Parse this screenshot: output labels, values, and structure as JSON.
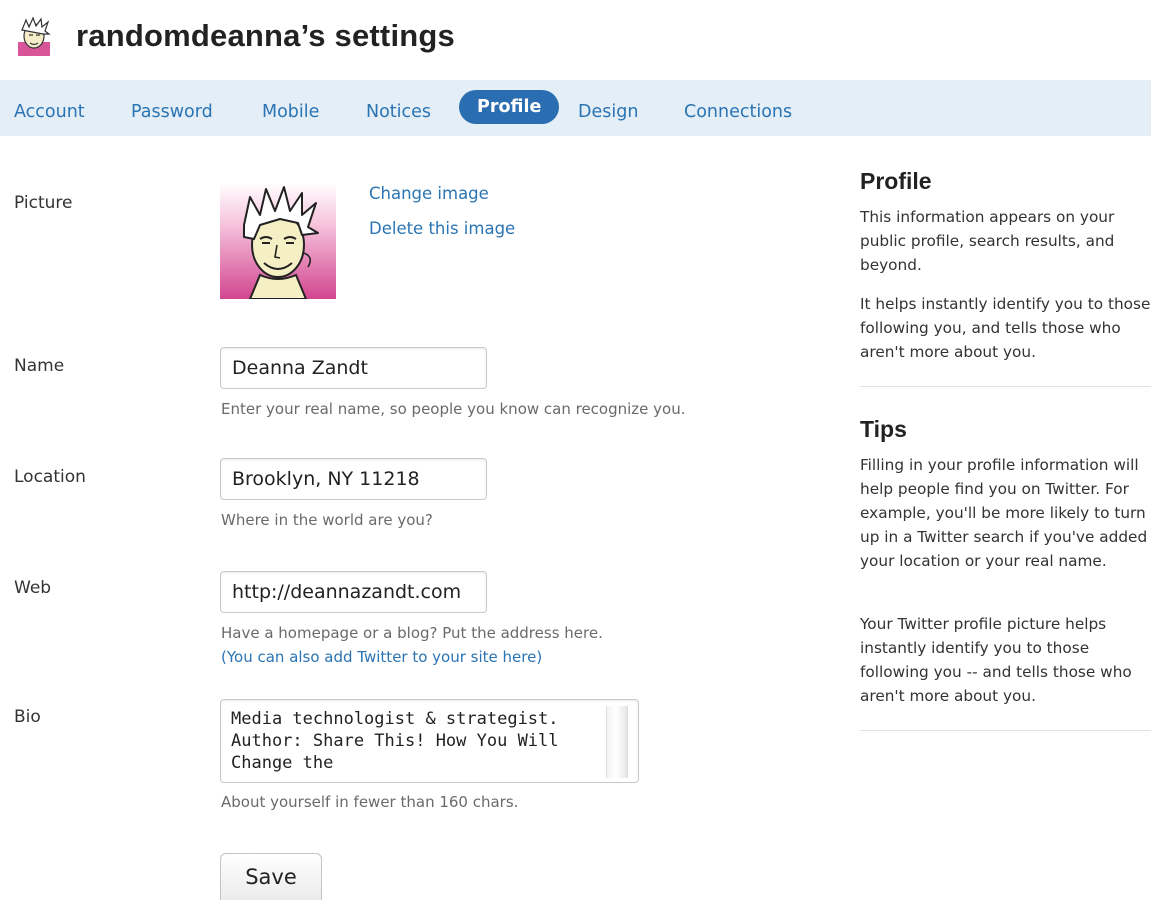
{
  "header": {
    "title": "randomdeanna’s settings"
  },
  "tabs": [
    {
      "label": "Account",
      "active": false
    },
    {
      "label": "Password",
      "active": false
    },
    {
      "label": "Mobile",
      "active": false
    },
    {
      "label": "Notices",
      "active": false
    },
    {
      "label": "Profile",
      "active": true
    },
    {
      "label": "Design",
      "active": false
    },
    {
      "label": "Connections",
      "active": false
    }
  ],
  "form": {
    "picture": {
      "label": "Picture",
      "change_label": "Change image",
      "delete_label": "Delete this image"
    },
    "name": {
      "label": "Name",
      "value": "Deanna Zandt",
      "help": "Enter your real name, so people you know can recognize you."
    },
    "location": {
      "label": "Location",
      "value": "Brooklyn, NY 11218",
      "help": "Where in the world are you?"
    },
    "web": {
      "label": "Web",
      "value": "http://deannazandt.com",
      "help": "Have a homepage or a blog? Put the address here.",
      "link": "(You can also add Twitter to your site here)"
    },
    "bio": {
      "label": "Bio",
      "value": "Media technologist & strategist. Author: Share This! How You Will Change the",
      "help": "About yourself in fewer than 160 chars."
    },
    "save_label": "Save"
  },
  "sidebar": {
    "profile": {
      "title": "Profile",
      "p1": "This information appears on your public profile, search results, and beyond.",
      "p2": "It helps instantly identify you to those following you, and tells those who aren't more about you."
    },
    "tips": {
      "title": "Tips",
      "p1": "Filling in your profile information will help people find you on Twitter. For example, you'll be more likely to turn up in a Twitter search if you've added your location or your real name.",
      "p2": "Your Twitter profile picture helps instantly identify you to those following you -- and tells those who aren't more about you."
    }
  },
  "colors": {
    "link": "#2b74b3",
    "tab_bar": "#e3eef6",
    "tab_active": "#2a6db0"
  }
}
